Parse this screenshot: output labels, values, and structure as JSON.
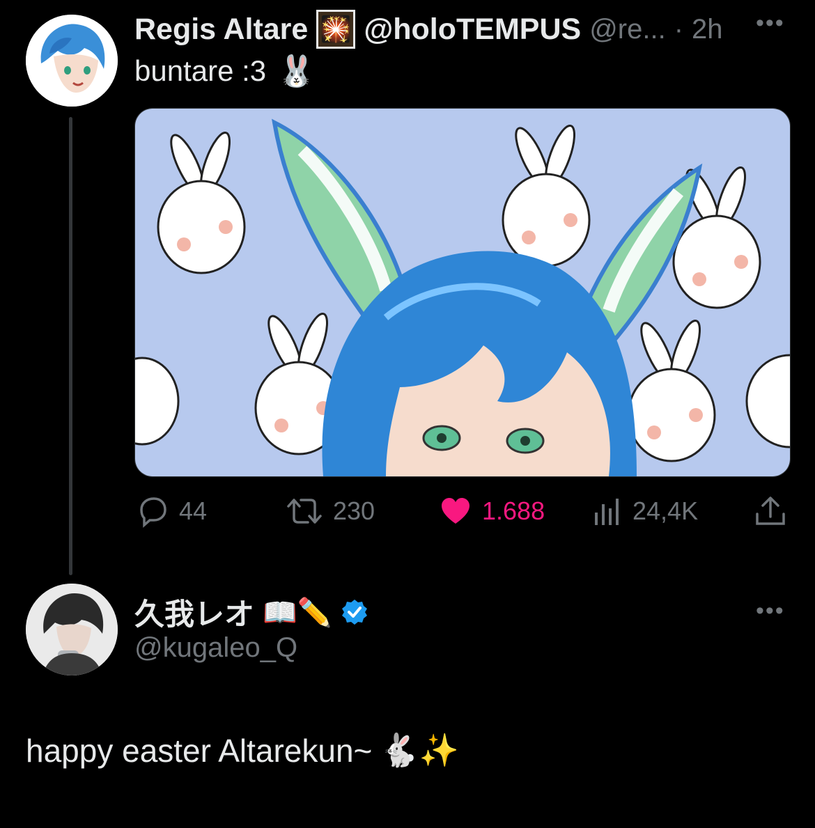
{
  "original_tweet": {
    "display_name": "Regis Altare",
    "name_emoji": "🎇",
    "name_suffix": "@holoTEMPUS",
    "handle_truncated": "@re...",
    "separator": "·",
    "time": "2h",
    "more_icon": "more-dots-icon",
    "text": "buntare :3",
    "text_emoji": "🐰",
    "actions": {
      "replies": "44",
      "retweets": "230",
      "likes": "1.688",
      "views": "24,4K"
    }
  },
  "reply_tweet": {
    "display_name": "久我レオ",
    "name_emojis": "📖✏️",
    "handle": "@kugaleo_Q",
    "verified": true,
    "text": "happy easter Altarekun~",
    "text_emojis": "🐇✨"
  },
  "colors": {
    "background": "#000000",
    "text_primary": "#e7e9ea",
    "text_secondary": "#71767b",
    "like_pink": "#f91880",
    "verified_blue": "#1d9bf0",
    "media_bg": "#b7c9ee"
  }
}
